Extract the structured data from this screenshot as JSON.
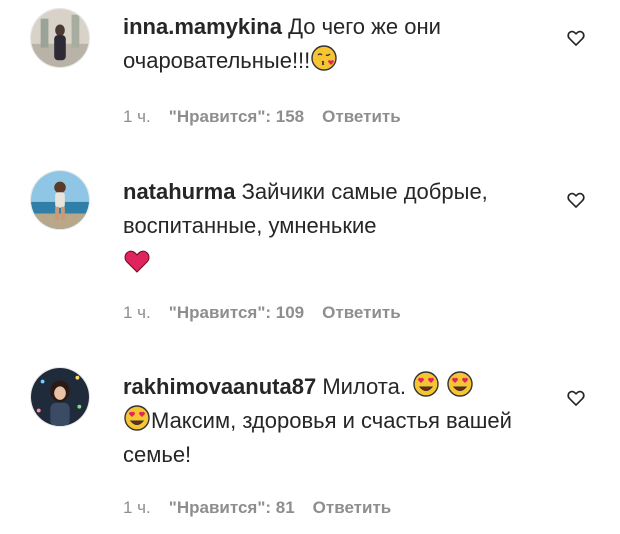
{
  "comments": [
    {
      "username": "inna.mamykina",
      "text_part1": "До чего же они очаровательные!!!",
      "time": "1 ч.",
      "likes": "\"Нравится\": 158",
      "reply": "Ответить"
    },
    {
      "username": "natahurma",
      "text_part1": "Зайчики самые добрые, воспитанные, умненькие",
      "time": "1 ч.",
      "likes": "\"Нравится\": 109",
      "reply": "Ответить"
    },
    {
      "username": "rakhimovaanuta87",
      "text_part1": "Милота.",
      "text_part2": "Максим, здоровья и счастья вашей семье!",
      "time": "1 ч.",
      "likes": "\"Нравится\": 81",
      "reply": "Ответить"
    }
  ],
  "icons": {
    "like": "heart-outline-icon",
    "wink_kiss": "face-blowing-kiss-emoji",
    "red_heart": "red-heart-emoji",
    "heart_eyes": "heart-eyes-emoji"
  },
  "colors": {
    "text": "#262626",
    "meta": "#8e8e8e",
    "heart": "#e0245e",
    "emoji_yellow": "#f7c531"
  }
}
